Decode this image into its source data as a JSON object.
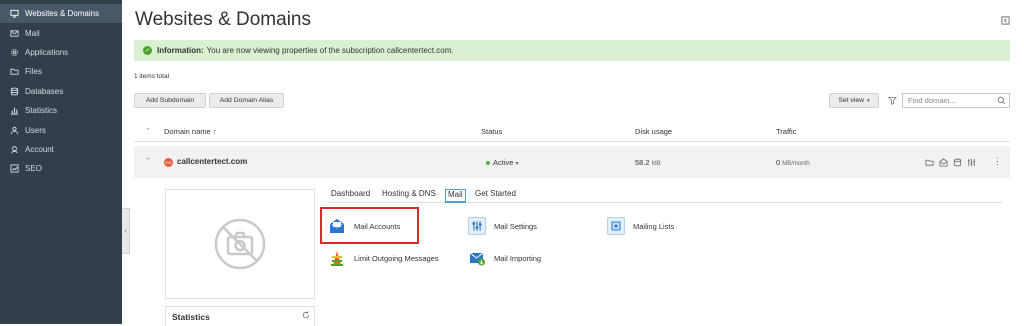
{
  "sidebar": {
    "items": [
      {
        "label": "Websites & Domains",
        "icon": "monitor-icon",
        "active": true
      },
      {
        "label": "Mail",
        "icon": "envelope-icon"
      },
      {
        "label": "Applications",
        "icon": "gear-icon"
      },
      {
        "label": "Files",
        "icon": "folder-icon"
      },
      {
        "label": "Databases",
        "icon": "database-icon"
      },
      {
        "label": "Statistics",
        "icon": "bar-chart-icon"
      },
      {
        "label": "Users",
        "icon": "user-icon"
      },
      {
        "label": "Account",
        "icon": "id-card-icon"
      },
      {
        "label": "SEO",
        "icon": "trend-icon"
      }
    ]
  },
  "header": {
    "title": "Websites & Domains"
  },
  "info": {
    "bold": "Information:",
    "text": "You are now viewing properties of the subscription callcentertect.com."
  },
  "list": {
    "items_total": "1 items total",
    "add_subdomain": "Add Subdomain",
    "add_domain_alias": "Add Domain Alias",
    "set_view": "Set view",
    "search_placeholder": "Find domain..."
  },
  "table": {
    "headers": {
      "domain": "Domain name ↑",
      "status": "Status",
      "disk": "Disk usage",
      "traffic": "Traffic"
    },
    "row": {
      "domain": "callcentertect.com",
      "status": "Active",
      "disk_value": "58.2",
      "disk_unit": "MB",
      "traffic_value": "0",
      "traffic_unit": "MB/month"
    }
  },
  "tabs": [
    "Dashboard",
    "Hosting & DNS",
    "Mail",
    "Get Started"
  ],
  "active_tab": "Mail",
  "tools": {
    "mail_accounts": "Mail Accounts",
    "mail_settings": "Mail Settings",
    "mailing_lists": "Mailing Lists",
    "limit_outgoing": "Limit Outgoing Messages",
    "mail_importing": "Mail Importing"
  },
  "stats": {
    "title": "Statistics"
  },
  "colors": {
    "sidebar": "#333e4a",
    "accent": "#4da3d4",
    "info_bg": "#d9f0d1",
    "highlight": "#d92a2a"
  }
}
